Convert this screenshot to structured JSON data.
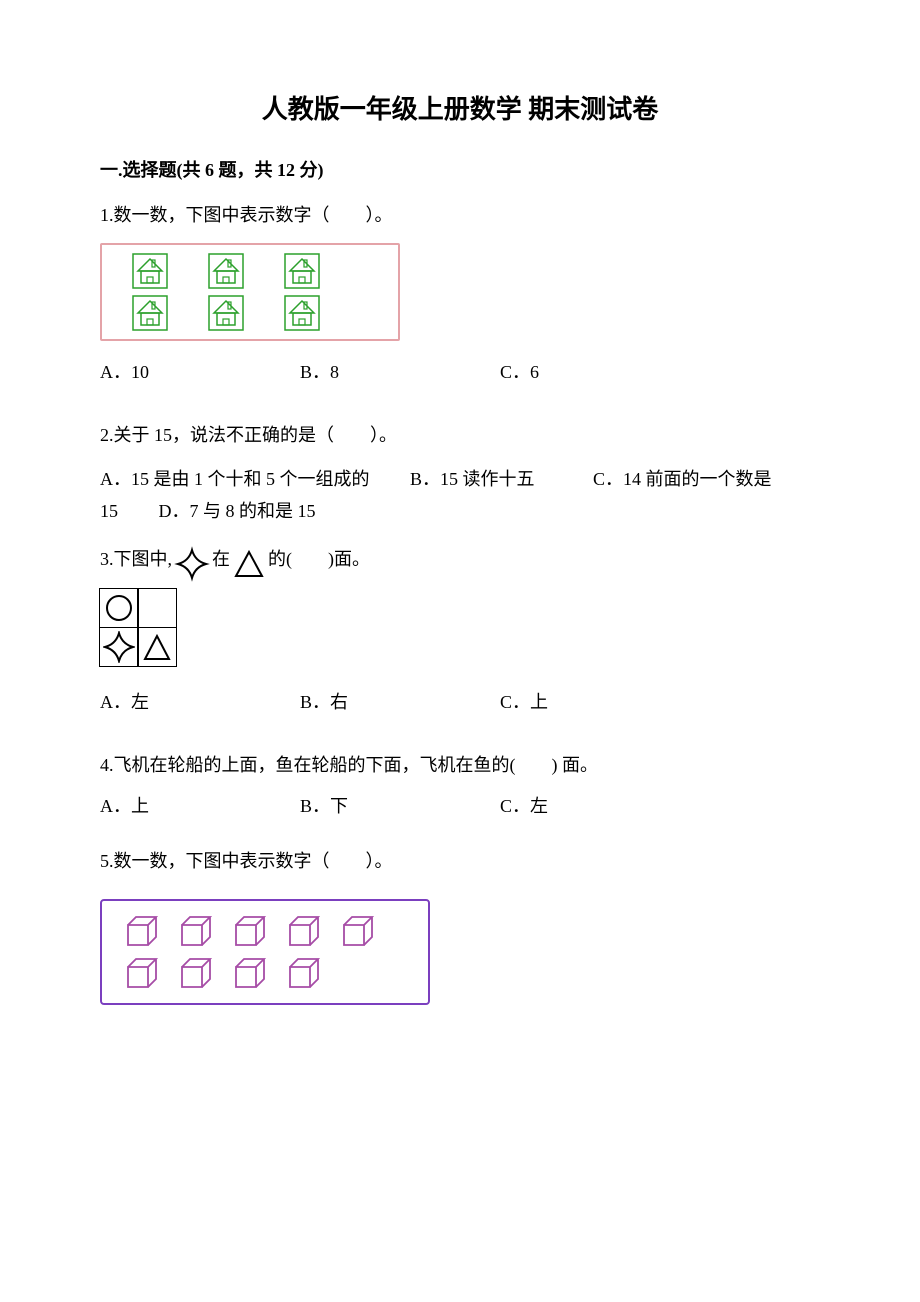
{
  "title": "人教版一年级上册数学 期末测试卷",
  "section1": {
    "header": "一.选择题(共 6 题，共 12 分)",
    "q1": {
      "text": "1.数一数，下图中表示数字（　　）。",
      "optA": "A．10",
      "optB": "B．8",
      "optC": "C．6"
    },
    "q2": {
      "text": "2.关于 15，说法不正确的是（　　）。",
      "optA": "A．15 是由 1 个十和 5 个一组成的",
      "optB": "B．15 读作十五",
      "optC": "C．14 前面的一个数是 15",
      "optD": "D．7 与 8 的和是 15"
    },
    "q3": {
      "prefix": "3.下图中,",
      "mid": "在",
      "suffix": "的(　　)面。",
      "optA": "A．左",
      "optB": "B．右",
      "optC": "C．上"
    },
    "q4": {
      "text": "4.飞机在轮船的上面，鱼在轮船的下面，飞机在鱼的(　　) 面。",
      "optA": "A．上",
      "optB": "B．下",
      "optC": "C．左"
    },
    "q5": {
      "text": "5.数一数，下图中表示数字（　　）。"
    }
  }
}
